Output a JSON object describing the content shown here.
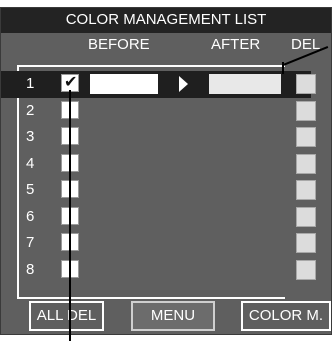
{
  "title": "COLOR MANAGEMENT LIST",
  "headers": {
    "before": "BEFORE",
    "after": "AFTER",
    "del": "DEL"
  },
  "rows": [
    {
      "num": "1",
      "checked": true,
      "selected": true
    },
    {
      "num": "2",
      "checked": false,
      "selected": false
    },
    {
      "num": "3",
      "checked": false,
      "selected": false
    },
    {
      "num": "4",
      "checked": false,
      "selected": false
    },
    {
      "num": "5",
      "checked": false,
      "selected": false
    },
    {
      "num": "6",
      "checked": false,
      "selected": false
    },
    {
      "num": "7",
      "checked": false,
      "selected": false
    },
    {
      "num": "8",
      "checked": false,
      "selected": false
    }
  ],
  "check_glyph": "✔",
  "buttons": {
    "all_del": "ALL DEL",
    "menu": "MENU",
    "color_m": "COLOR M."
  },
  "colors": {
    "panel": "#5f5f5f",
    "title_bar": "#232323",
    "selected_row": "#1f1f1f",
    "text": "#ffffff"
  }
}
